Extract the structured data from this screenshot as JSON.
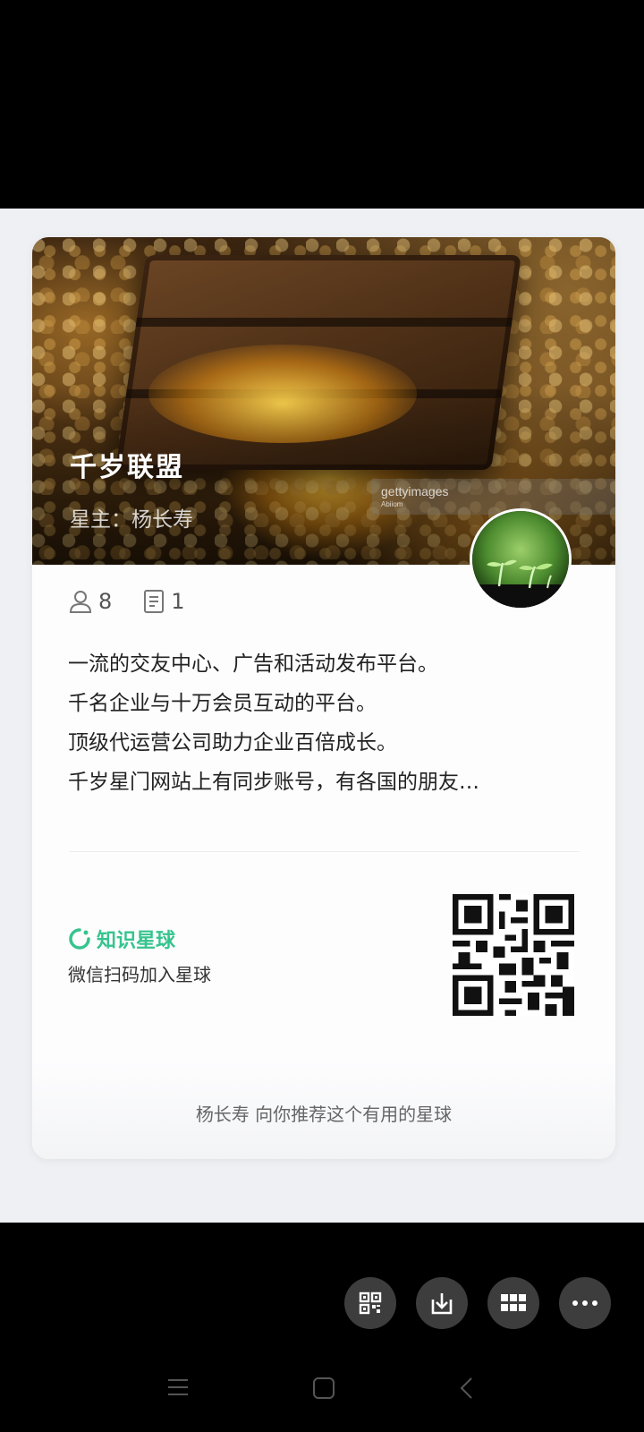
{
  "card": {
    "title": "千岁联盟",
    "owner": "星主：杨长寿",
    "watermark": {
      "brand": "gettyimages",
      "credit": "Abiiom"
    },
    "stats": {
      "members": "8",
      "posts": "1"
    },
    "description": [
      "一流的交友中心、广告和活动发布平台。",
      "千名企业与十万会员互动的平台。",
      "顶级代运营公司助力企业百倍成长。",
      "千岁星门网站上有同步账号，有各国的朋友…"
    ],
    "brand_label": "知识星球",
    "scan_text": "微信扫码加入星球",
    "footer_text": "杨长寿 向你推荐这个有用的星球"
  },
  "colors": {
    "brand_green": "#36c48e",
    "panel_bg": "#eef0f3",
    "action_button_bg": "#3d3d3d"
  },
  "actions": [
    {
      "icon": "qr-code-icon"
    },
    {
      "icon": "download-icon"
    },
    {
      "icon": "grid-icon"
    },
    {
      "icon": "more-icon"
    }
  ],
  "system_nav": [
    "menu-icon",
    "home-icon",
    "back-icon"
  ]
}
